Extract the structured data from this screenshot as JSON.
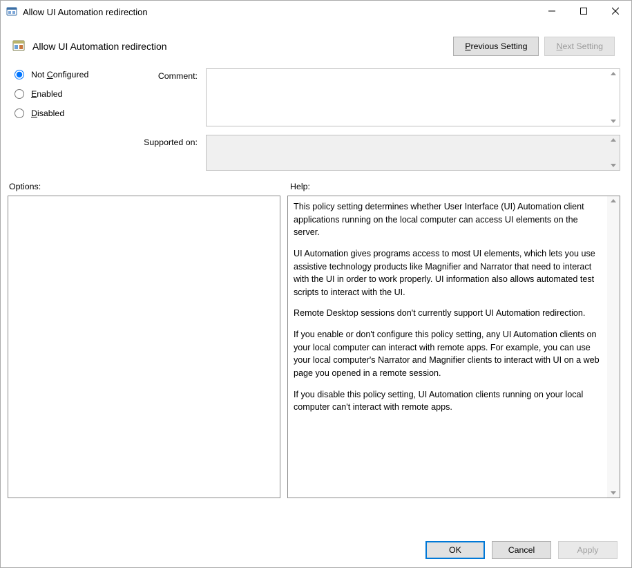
{
  "window": {
    "title": "Allow UI Automation redirection"
  },
  "header": {
    "policy_title": "Allow UI Automation redirection",
    "prev_label": "Previous Setting",
    "next_label": "Next Setting",
    "next_disabled": true
  },
  "state": {
    "not_configured_label": "Not Configured",
    "enabled_label": "Enabled",
    "disabled_label": "Disabled",
    "selected": "not_configured"
  },
  "comment": {
    "label": "Comment:",
    "value": ""
  },
  "supported": {
    "label": "Supported on:",
    "value": ""
  },
  "panes": {
    "options_label": "Options:",
    "help_label": "Help:"
  },
  "help": {
    "p1": "This policy setting determines whether User Interface (UI) Automation client applications running on the local computer can access UI elements on the server.",
    "p2": "UI Automation gives programs access to most UI elements, which lets you use assistive technology products like Magnifier and Narrator that need to interact with the UI in order to work properly. UI information also allows automated test scripts to interact with the UI.",
    "p3": "Remote Desktop sessions don't currently support UI Automation redirection.",
    "p4": "If you enable or don't configure this policy setting, any UI Automation clients on your local computer can interact with remote apps. For example, you can use your local computer's Narrator and Magnifier clients to interact with UI on a web page you opened in a remote session.",
    "p5": "If you disable this policy setting, UI Automation clients running on your local computer can't interact with remote apps."
  },
  "footer": {
    "ok": "OK",
    "cancel": "Cancel",
    "apply": "Apply",
    "apply_disabled": true
  }
}
